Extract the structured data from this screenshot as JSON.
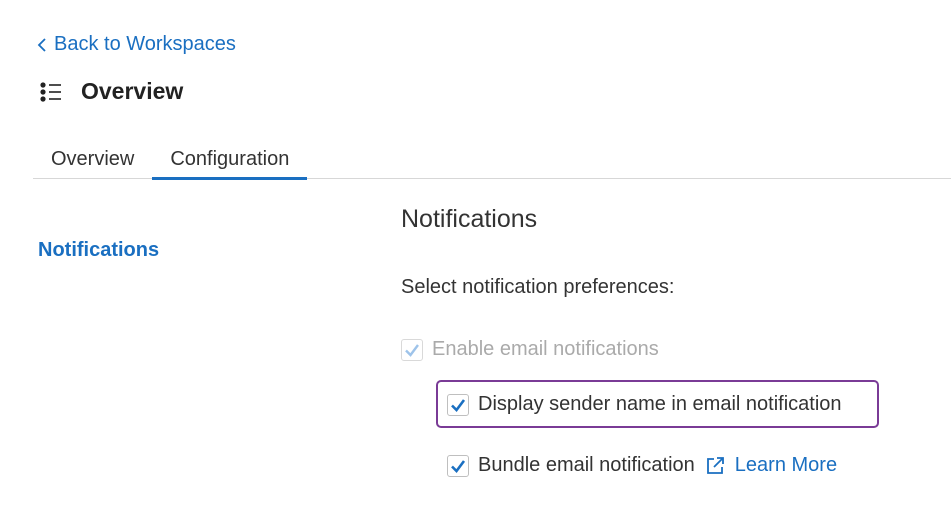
{
  "nav": {
    "back_label": "Back to Workspaces"
  },
  "header": {
    "title": "Overview"
  },
  "tabs": [
    {
      "label": "Overview",
      "active": false
    },
    {
      "label": "Configuration",
      "active": true
    }
  ],
  "sidebar": {
    "items": [
      {
        "label": "Notifications",
        "active": true
      }
    ]
  },
  "notifications": {
    "title": "Notifications",
    "prompt": "Select notification preferences:",
    "options": [
      {
        "label": "Enable email notifications",
        "checked": true,
        "disabled": true
      },
      {
        "label": "Display sender name in email notification",
        "checked": true,
        "disabled": false,
        "highlighted": true
      },
      {
        "label": "Bundle email notification",
        "checked": true,
        "disabled": false
      }
    ],
    "learn_more_label": "Learn More"
  },
  "icons": {
    "back": "chevron-left-icon",
    "list": "list-icon",
    "check": "checkmark-icon",
    "external": "external-link-icon"
  },
  "colors": {
    "accent": "#1a6fc1",
    "highlight_border": "#7a3b96",
    "disabled_text": "#aaaaaa"
  }
}
